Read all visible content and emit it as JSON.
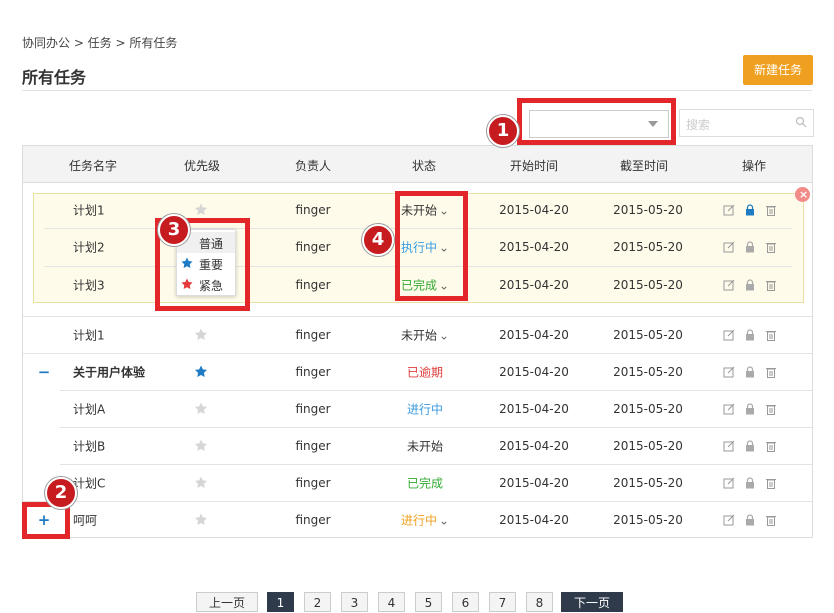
{
  "breadcrumb": "协同办公 > 任务 > 所有任务",
  "page_title": "所有任务",
  "new_task_button": "新建任务",
  "search_placeholder": "搜索",
  "callouts": [
    "1",
    "2",
    "3",
    "4"
  ],
  "columns": [
    "任务名字",
    "优先级",
    "负责人",
    "状态",
    "开始时间",
    "截至时间",
    "操作"
  ],
  "priority_menu": [
    "普通",
    "重要",
    "紧急"
  ],
  "rows": [
    {
      "name": "计划1",
      "priority": "normal",
      "owner": "finger",
      "status": "未开始",
      "status_dropdown": true,
      "start": "2015-04-20",
      "end": "2015-05-20"
    },
    {
      "name": "计划2",
      "priority": "normal",
      "owner": "finger",
      "status": "执行中",
      "status_dropdown": true,
      "start": "2015-04-20",
      "end": "2015-05-20"
    },
    {
      "name": "计划3",
      "priority": "normal",
      "owner": "finger",
      "status": "已完成",
      "status_dropdown": true,
      "start": "2015-04-20",
      "end": "2015-05-20"
    },
    {
      "name": "计划1",
      "priority": "normal",
      "owner": "finger",
      "status": "未开始",
      "status_dropdown": true,
      "start": "2015-04-20",
      "end": "2015-05-20"
    },
    {
      "name": "关于用户体验",
      "priority": "important",
      "owner": "finger",
      "status": "已逾期",
      "status_dropdown": false,
      "start": "2015-04-20",
      "end": "2015-05-20",
      "toggle": "−",
      "bold": true
    },
    {
      "name": "计划A",
      "priority": "normal",
      "owner": "finger",
      "status": "进行中",
      "status_dropdown": false,
      "start": "2015-04-20",
      "end": "2015-05-20"
    },
    {
      "name": "计划B",
      "priority": "normal",
      "owner": "finger",
      "status": "未开始",
      "status_dropdown": false,
      "start": "2015-04-20",
      "end": "2015-05-20"
    },
    {
      "name": "计划C",
      "priority": "normal",
      "owner": "finger",
      "status": "已完成",
      "status_dropdown": false,
      "start": "2015-04-20",
      "end": "2015-05-20"
    },
    {
      "name": "呵呵",
      "priority": "normal",
      "owner": "finger",
      "status": "进行中",
      "status_dropdown": true,
      "start": "2015-04-20",
      "end": "2015-05-20",
      "toggle": "+"
    }
  ],
  "status_colors": {
    "未开始": "#333333",
    "执行中": "#3a9be0",
    "已完成": "#33aa33",
    "已逾期": "#e03a3a",
    "进行中": "#3a9be0"
  },
  "status_colors_last": "#f0a020",
  "icons": [
    "edit-icon",
    "lock-icon",
    "trash-icon",
    "star-icon",
    "search-icon",
    "close-icon"
  ],
  "pagination": {
    "prev": "上一页",
    "pages": [
      "1",
      "2",
      "3",
      "4",
      "5",
      "6",
      "7",
      "8"
    ],
    "next": "下一页",
    "active": "1"
  }
}
